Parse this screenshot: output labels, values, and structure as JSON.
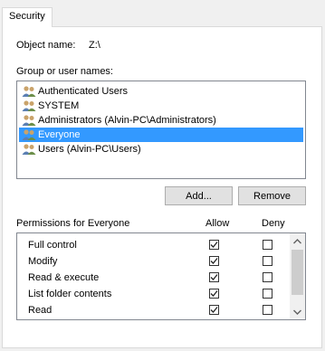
{
  "tab": {
    "label": "Security"
  },
  "object": {
    "label": "Object name:",
    "value": "Z:\\"
  },
  "groups": {
    "label": "Group or user names:",
    "items": [
      {
        "label": "Authenticated Users",
        "selected": false
      },
      {
        "label": "SYSTEM",
        "selected": false
      },
      {
        "label": "Administrators (Alvin-PC\\Administrators)",
        "selected": false
      },
      {
        "label": "Everyone",
        "selected": true
      },
      {
        "label": "Users (Alvin-PC\\Users)",
        "selected": false
      }
    ]
  },
  "buttons": {
    "add": "Add...",
    "remove": "Remove"
  },
  "permissions": {
    "label": "Permissions for Everyone",
    "allow_header": "Allow",
    "deny_header": "Deny",
    "rows": [
      {
        "label": "Full control",
        "allow": true,
        "deny": false
      },
      {
        "label": "Modify",
        "allow": true,
        "deny": false
      },
      {
        "label": "Read & execute",
        "allow": true,
        "deny": false
      },
      {
        "label": "List folder contents",
        "allow": true,
        "deny": false
      },
      {
        "label": "Read",
        "allow": true,
        "deny": false
      }
    ]
  },
  "colors": {
    "selection": "#3399ff",
    "border": "#828790",
    "background": "#f0f0f0"
  }
}
